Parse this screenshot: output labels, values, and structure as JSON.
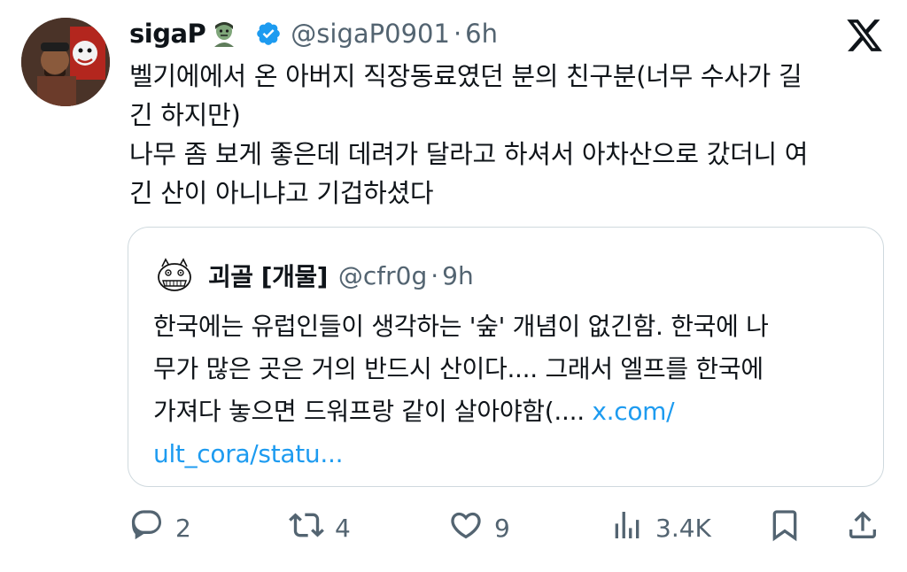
{
  "tweet": {
    "display_name": "sigaP",
    "handle": "@sigaP0901",
    "separator": "·",
    "time": "6h",
    "text": "벨기에에서 온 아버지 직장동료였던 분의 친구분(너무 수사가 길\n긴 하지만)\n나무 좀 보게 좋은데 데려가 달라고 하셔서 아차산으로 갔더니 여\n긴 산이 아니냐고 기겁하셨다",
    "name_emoji": "zombie-icon",
    "verified_icon": "verified-badge-icon",
    "brand_icon": "x-logo-icon"
  },
  "quote": {
    "display_name": "괴골 [개물]",
    "handle": "@cfr0g",
    "separator": "·",
    "time": "9h",
    "text": "한국에는 유럽인들이 생각하는 '숲' 개념이 없긴함. 한국에 나\n무가 많은 곳은 거의 반드시 산이다.... 그래서 엘프를 한국에\n가져다 놓으면 드워프랑 같이 살아야함(.... ",
    "link": "x.com/\nult_cora/statu..."
  },
  "actions": {
    "reply_count": "2",
    "retweet_count": "4",
    "like_count": "9",
    "views_count": "3.4K"
  },
  "colors": {
    "text": "#0f1419",
    "secondary": "#536471",
    "link": "#1d9bf0",
    "border": "#cfd9de",
    "verified": "#1d9bf0"
  }
}
